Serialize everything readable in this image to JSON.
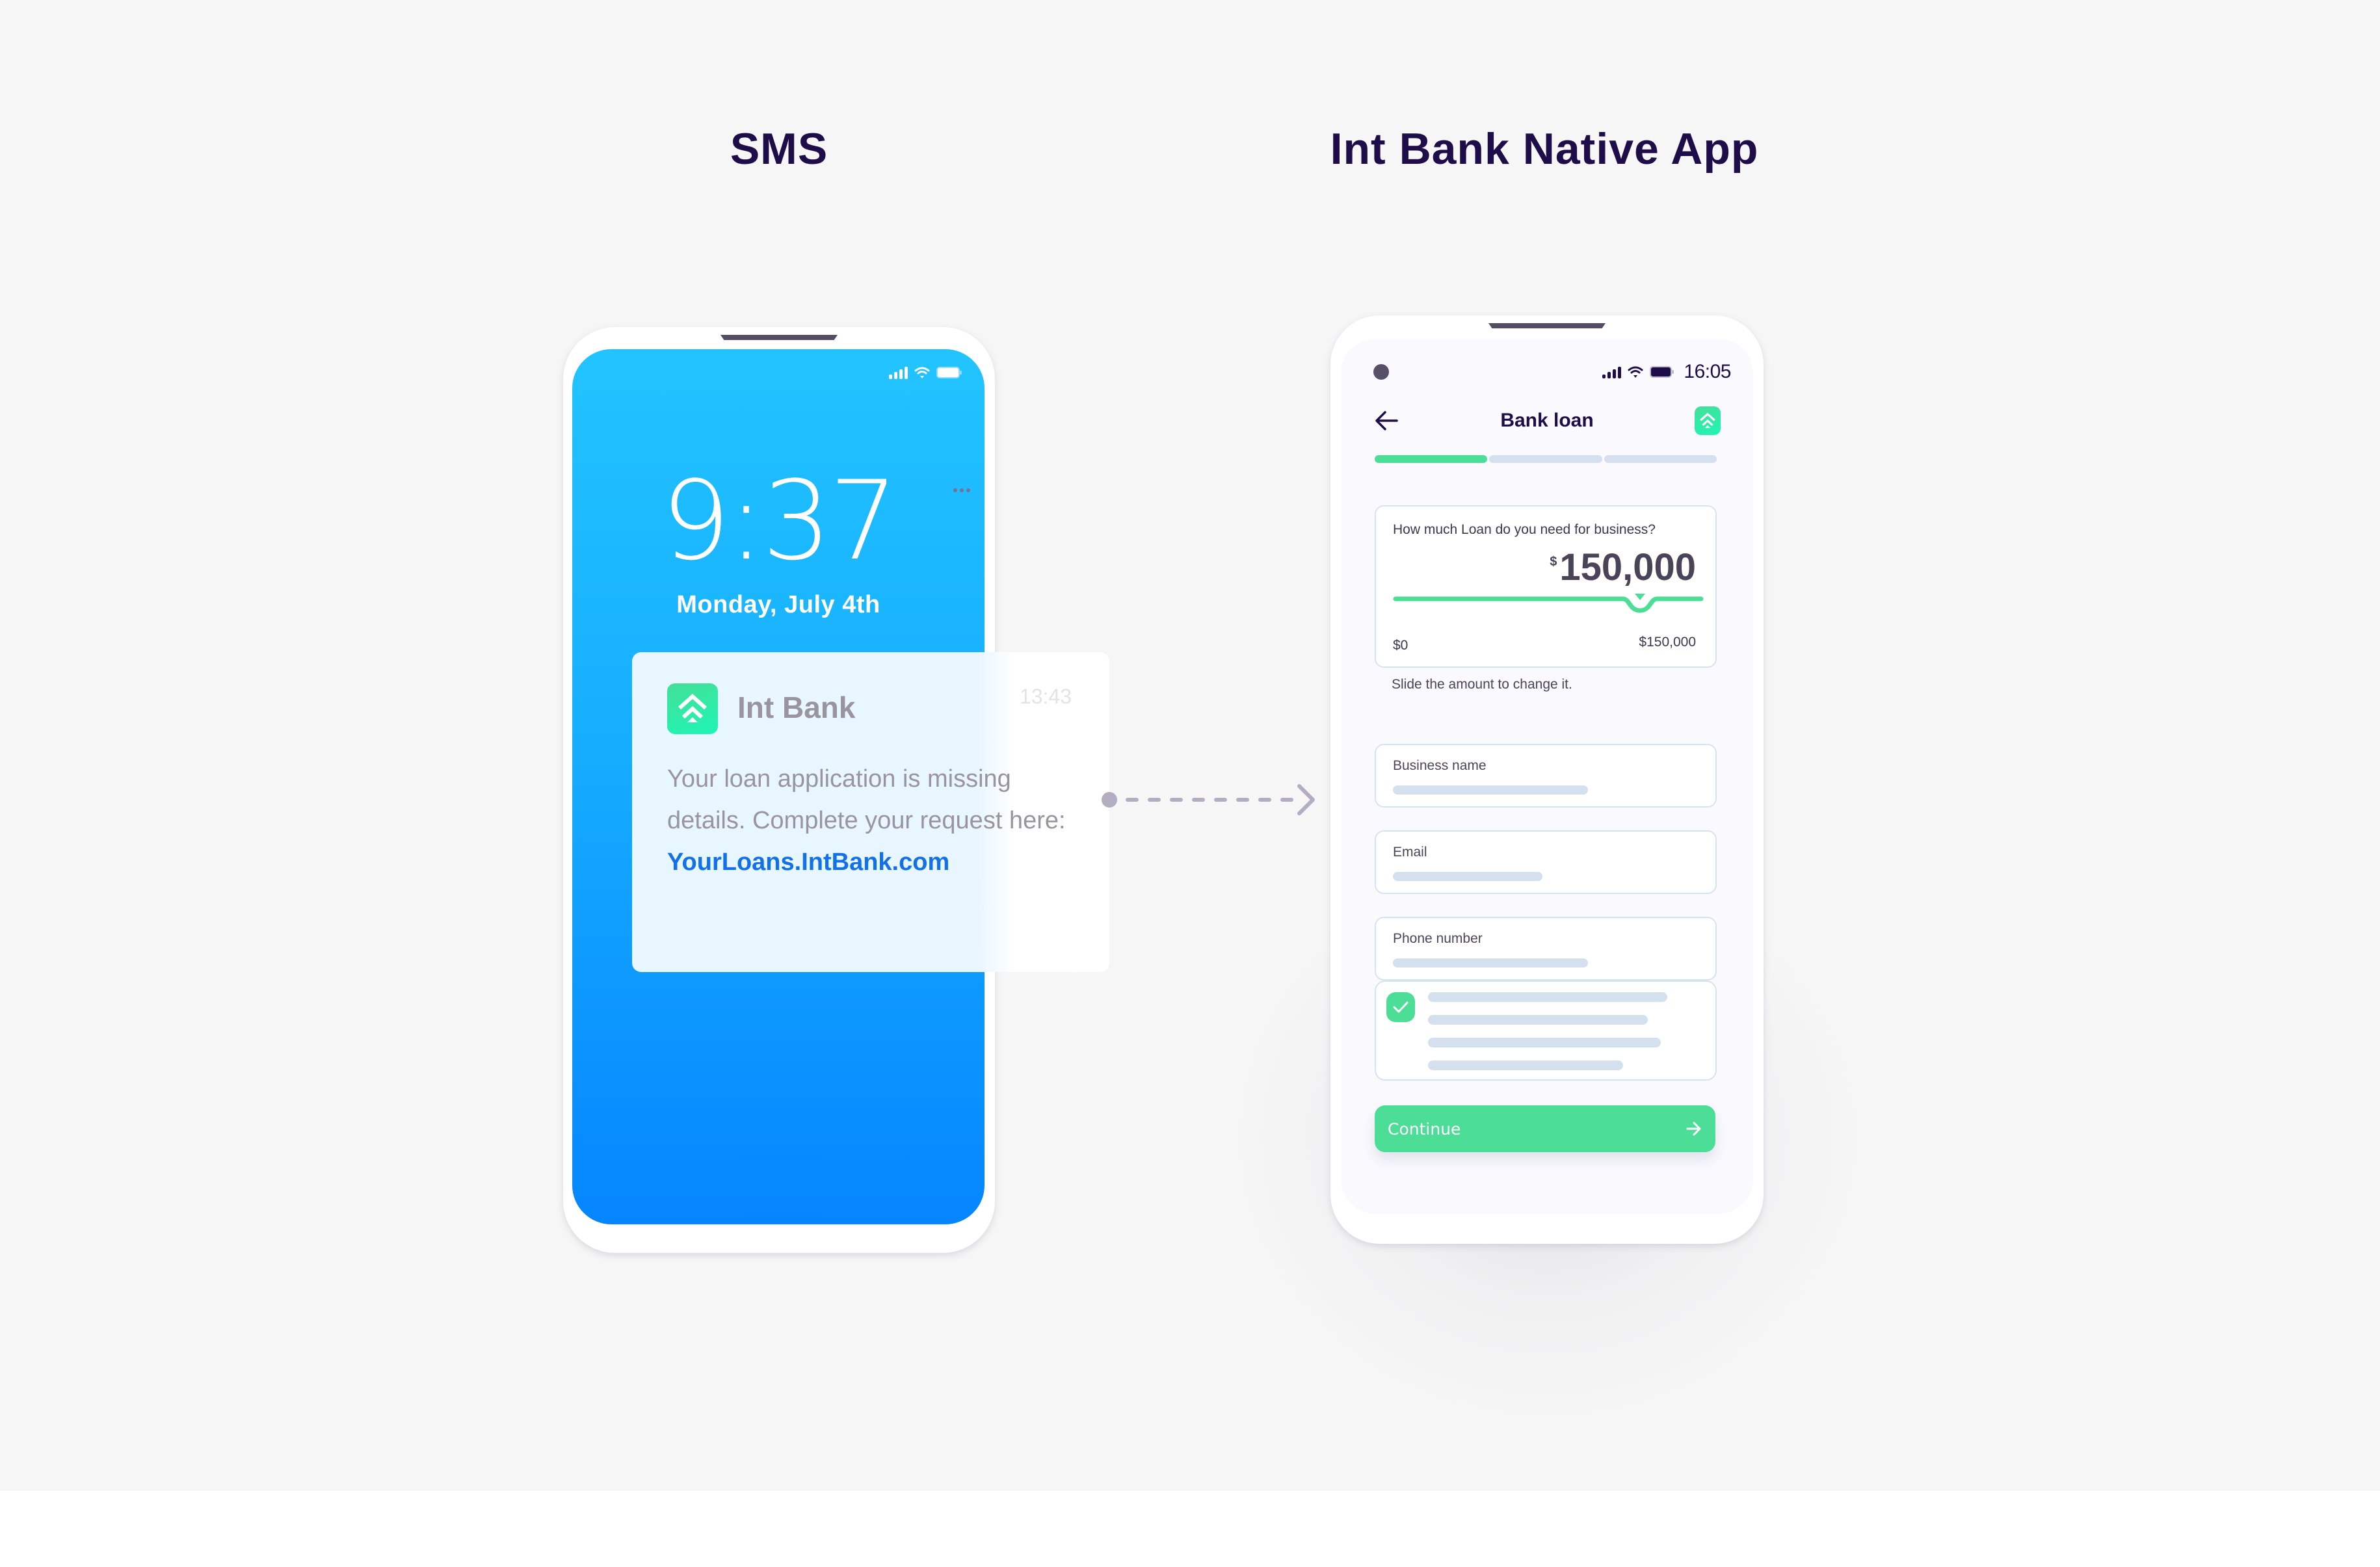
{
  "titles": {
    "sms": "SMS",
    "app": "Int Bank Native App"
  },
  "sms_phone": {
    "status_icons": [
      "signal-icon",
      "wifi-icon",
      "battery-icon"
    ],
    "clock": "9:37",
    "date": "Monday, July 4th",
    "notification": {
      "sender": "Int Bank",
      "time": "13:43",
      "body_prefix": "Your loan application is missing details. Complete your request here: ",
      "link": "YourLoans.IntBank.com"
    }
  },
  "app_phone": {
    "status": {
      "time": "16:05",
      "icons": [
        "signal-icon",
        "wifi-icon",
        "battery-icon"
      ]
    },
    "header": {
      "title": "Bank loan",
      "back_icon": "arrow-left-icon",
      "logo_icon": "int-bank-logo-icon"
    },
    "progress": {
      "steps_total": 3,
      "steps_completed": 1
    },
    "loan": {
      "question": "How much Loan do you need for business?",
      "currency": "$",
      "amount": "150,000",
      "min_label": "$0",
      "max_label": "$150,000",
      "slider_value_fraction": 0.8,
      "hint": "Slide the amount to change it."
    },
    "fields": [
      {
        "label": "Business name"
      },
      {
        "label": "Email"
      },
      {
        "label": "Phone number"
      }
    ],
    "terms": {
      "checked": true
    },
    "continue_label": "Continue"
  },
  "colors": {
    "title": "#1f0d4a",
    "accent_green": "#4cde96",
    "link_blue": "#1271e8",
    "lock_gradient_top": "#22c4ff",
    "lock_gradient_bottom": "#0585ff",
    "placeholder_bar": "#d5e0ee"
  }
}
